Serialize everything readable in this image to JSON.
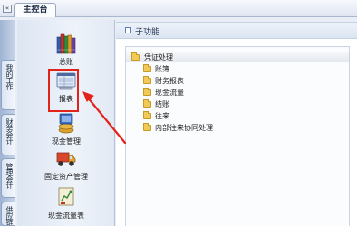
{
  "topbar": {
    "collapse_glyph": "«",
    "tab_label": "主控台"
  },
  "vertical_tabs": [
    {
      "label": "我的工作"
    },
    {
      "label": "财务会计"
    },
    {
      "label": "管理会计"
    },
    {
      "label": "供应链"
    }
  ],
  "icon_panel": {
    "items": [
      {
        "label": "总账",
        "icon": "books-icon"
      },
      {
        "label": "报表",
        "icon": "report-icon"
      },
      {
        "label": "现金管理",
        "icon": "cash-management-icon"
      },
      {
        "label": "固定资产管理",
        "icon": "fixed-assets-truck-icon"
      },
      {
        "label": "现金流量表",
        "icon": "cash-flow-statement-icon"
      }
    ],
    "highlighted": "报表"
  },
  "content": {
    "section_title": "子功能",
    "items": [
      {
        "label": "凭证处理"
      },
      {
        "label": "账簿"
      },
      {
        "label": "财务报表"
      },
      {
        "label": "现金流量"
      },
      {
        "label": "结账"
      },
      {
        "label": "往来"
      },
      {
        "label": "内部往来协同处理"
      }
    ]
  },
  "annotation": {
    "color": "#e2231a",
    "shape": "red-arrow-and-box"
  }
}
